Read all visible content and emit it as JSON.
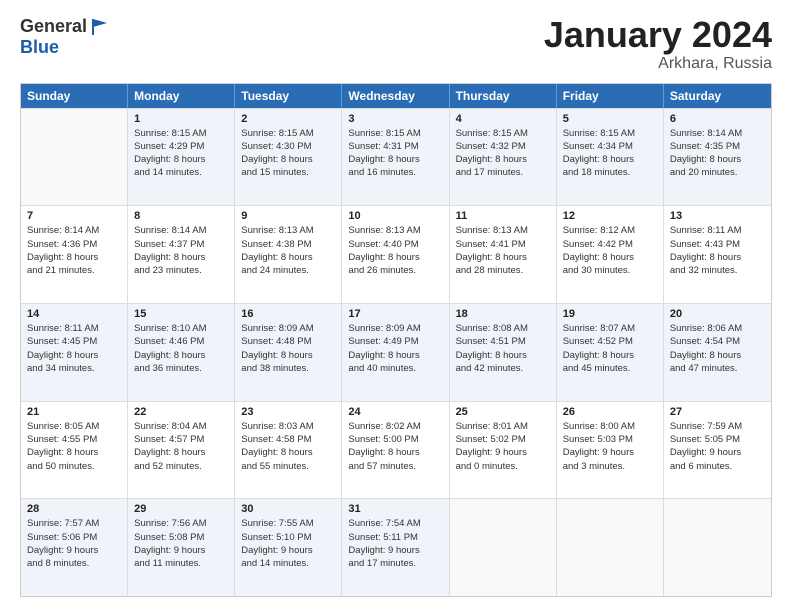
{
  "header": {
    "logo_line1": "General",
    "logo_line2": "Blue",
    "month": "January 2024",
    "location": "Arkhara, Russia"
  },
  "days_of_week": [
    "Sunday",
    "Monday",
    "Tuesday",
    "Wednesday",
    "Thursday",
    "Friday",
    "Saturday"
  ],
  "rows": [
    [
      {
        "day": "",
        "lines": [],
        "empty": true
      },
      {
        "day": "1",
        "lines": [
          "Sunrise: 8:15 AM",
          "Sunset: 4:29 PM",
          "Daylight: 8 hours",
          "and 14 minutes."
        ]
      },
      {
        "day": "2",
        "lines": [
          "Sunrise: 8:15 AM",
          "Sunset: 4:30 PM",
          "Daylight: 8 hours",
          "and 15 minutes."
        ]
      },
      {
        "day": "3",
        "lines": [
          "Sunrise: 8:15 AM",
          "Sunset: 4:31 PM",
          "Daylight: 8 hours",
          "and 16 minutes."
        ]
      },
      {
        "day": "4",
        "lines": [
          "Sunrise: 8:15 AM",
          "Sunset: 4:32 PM",
          "Daylight: 8 hours",
          "and 17 minutes."
        ]
      },
      {
        "day": "5",
        "lines": [
          "Sunrise: 8:15 AM",
          "Sunset: 4:34 PM",
          "Daylight: 8 hours",
          "and 18 minutes."
        ]
      },
      {
        "day": "6",
        "lines": [
          "Sunrise: 8:14 AM",
          "Sunset: 4:35 PM",
          "Daylight: 8 hours",
          "and 20 minutes."
        ]
      }
    ],
    [
      {
        "day": "7",
        "lines": [
          "Sunrise: 8:14 AM",
          "Sunset: 4:36 PM",
          "Daylight: 8 hours",
          "and 21 minutes."
        ]
      },
      {
        "day": "8",
        "lines": [
          "Sunrise: 8:14 AM",
          "Sunset: 4:37 PM",
          "Daylight: 8 hours",
          "and 23 minutes."
        ]
      },
      {
        "day": "9",
        "lines": [
          "Sunrise: 8:13 AM",
          "Sunset: 4:38 PM",
          "Daylight: 8 hours",
          "and 24 minutes."
        ]
      },
      {
        "day": "10",
        "lines": [
          "Sunrise: 8:13 AM",
          "Sunset: 4:40 PM",
          "Daylight: 8 hours",
          "and 26 minutes."
        ]
      },
      {
        "day": "11",
        "lines": [
          "Sunrise: 8:13 AM",
          "Sunset: 4:41 PM",
          "Daylight: 8 hours",
          "and 28 minutes."
        ]
      },
      {
        "day": "12",
        "lines": [
          "Sunrise: 8:12 AM",
          "Sunset: 4:42 PM",
          "Daylight: 8 hours",
          "and 30 minutes."
        ]
      },
      {
        "day": "13",
        "lines": [
          "Sunrise: 8:11 AM",
          "Sunset: 4:43 PM",
          "Daylight: 8 hours",
          "and 32 minutes."
        ]
      }
    ],
    [
      {
        "day": "14",
        "lines": [
          "Sunrise: 8:11 AM",
          "Sunset: 4:45 PM",
          "Daylight: 8 hours",
          "and 34 minutes."
        ]
      },
      {
        "day": "15",
        "lines": [
          "Sunrise: 8:10 AM",
          "Sunset: 4:46 PM",
          "Daylight: 8 hours",
          "and 36 minutes."
        ]
      },
      {
        "day": "16",
        "lines": [
          "Sunrise: 8:09 AM",
          "Sunset: 4:48 PM",
          "Daylight: 8 hours",
          "and 38 minutes."
        ]
      },
      {
        "day": "17",
        "lines": [
          "Sunrise: 8:09 AM",
          "Sunset: 4:49 PM",
          "Daylight: 8 hours",
          "and 40 minutes."
        ]
      },
      {
        "day": "18",
        "lines": [
          "Sunrise: 8:08 AM",
          "Sunset: 4:51 PM",
          "Daylight: 8 hours",
          "and 42 minutes."
        ]
      },
      {
        "day": "19",
        "lines": [
          "Sunrise: 8:07 AM",
          "Sunset: 4:52 PM",
          "Daylight: 8 hours",
          "and 45 minutes."
        ]
      },
      {
        "day": "20",
        "lines": [
          "Sunrise: 8:06 AM",
          "Sunset: 4:54 PM",
          "Daylight: 8 hours",
          "and 47 minutes."
        ]
      }
    ],
    [
      {
        "day": "21",
        "lines": [
          "Sunrise: 8:05 AM",
          "Sunset: 4:55 PM",
          "Daylight: 8 hours",
          "and 50 minutes."
        ]
      },
      {
        "day": "22",
        "lines": [
          "Sunrise: 8:04 AM",
          "Sunset: 4:57 PM",
          "Daylight: 8 hours",
          "and 52 minutes."
        ]
      },
      {
        "day": "23",
        "lines": [
          "Sunrise: 8:03 AM",
          "Sunset: 4:58 PM",
          "Daylight: 8 hours",
          "and 55 minutes."
        ]
      },
      {
        "day": "24",
        "lines": [
          "Sunrise: 8:02 AM",
          "Sunset: 5:00 PM",
          "Daylight: 8 hours",
          "and 57 minutes."
        ]
      },
      {
        "day": "25",
        "lines": [
          "Sunrise: 8:01 AM",
          "Sunset: 5:02 PM",
          "Daylight: 9 hours",
          "and 0 minutes."
        ]
      },
      {
        "day": "26",
        "lines": [
          "Sunrise: 8:00 AM",
          "Sunset: 5:03 PM",
          "Daylight: 9 hours",
          "and 3 minutes."
        ]
      },
      {
        "day": "27",
        "lines": [
          "Sunrise: 7:59 AM",
          "Sunset: 5:05 PM",
          "Daylight: 9 hours",
          "and 6 minutes."
        ]
      }
    ],
    [
      {
        "day": "28",
        "lines": [
          "Sunrise: 7:57 AM",
          "Sunset: 5:06 PM",
          "Daylight: 9 hours",
          "and 8 minutes."
        ]
      },
      {
        "day": "29",
        "lines": [
          "Sunrise: 7:56 AM",
          "Sunset: 5:08 PM",
          "Daylight: 9 hours",
          "and 11 minutes."
        ]
      },
      {
        "day": "30",
        "lines": [
          "Sunrise: 7:55 AM",
          "Sunset: 5:10 PM",
          "Daylight: 9 hours",
          "and 14 minutes."
        ]
      },
      {
        "day": "31",
        "lines": [
          "Sunrise: 7:54 AM",
          "Sunset: 5:11 PM",
          "Daylight: 9 hours",
          "and 17 minutes."
        ]
      },
      {
        "day": "",
        "lines": [],
        "empty": true
      },
      {
        "day": "",
        "lines": [],
        "empty": true
      },
      {
        "day": "",
        "lines": [],
        "empty": true
      }
    ]
  ]
}
